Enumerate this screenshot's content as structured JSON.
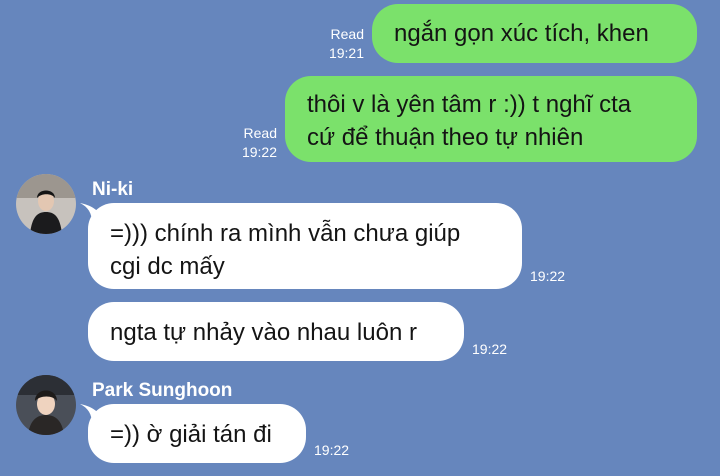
{
  "colors": {
    "background": "#6686bd",
    "outgoing_bubble": "#7be16b",
    "incoming_bubble": "#ffffff",
    "meta_text": "#ffffff"
  },
  "messages": [
    {
      "direction": "outgoing",
      "lines": [
        "ngắn gọn xúc tích, khen"
      ],
      "read": "Read",
      "time": "19:21"
    },
    {
      "direction": "outgoing",
      "lines": [
        "thôi v là yên tâm r :)) t nghĩ cta",
        "cứ để thuận theo tự nhiên"
      ],
      "read": "Read",
      "time": "19:22"
    },
    {
      "direction": "incoming",
      "sender": "Ni-ki",
      "avatar": "avatar-icon",
      "lines": [
        "=))) chính ra mình vẫn chưa giúp",
        "cgi dc mấy"
      ],
      "time": "19:22"
    },
    {
      "direction": "incoming",
      "lines": [
        "ngta tự nhảy vào nhau luôn r"
      ],
      "time": "19:22"
    },
    {
      "direction": "incoming",
      "sender": "Park Sunghoon",
      "avatar": "avatar-icon",
      "lines": [
        "=)) ờ giải tán đi"
      ],
      "time": "19:22"
    }
  ]
}
